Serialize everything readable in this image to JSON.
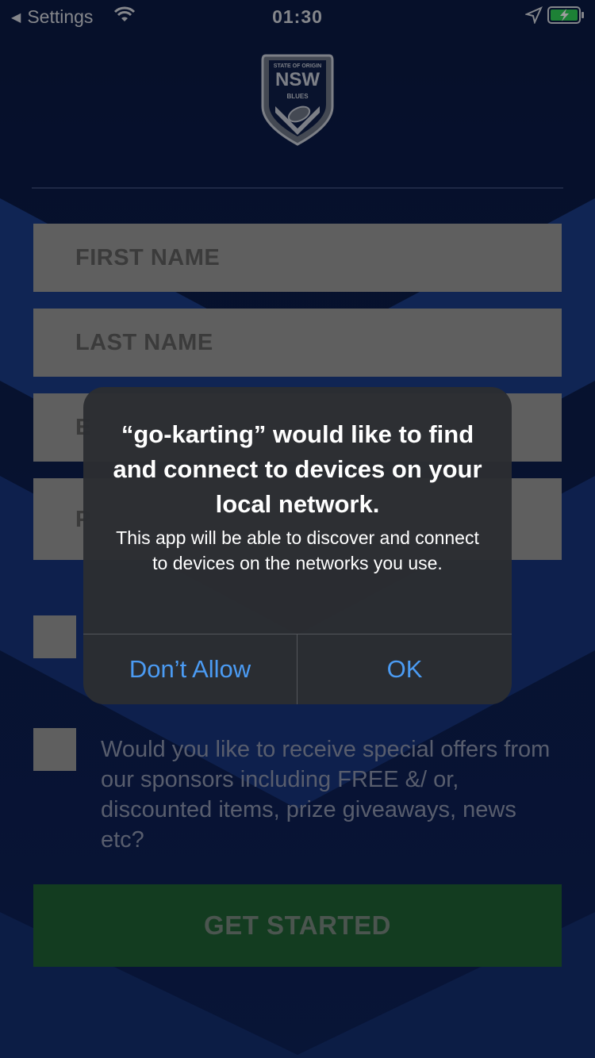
{
  "status_bar": {
    "back_label": "Settings",
    "time": "01:30",
    "icons": [
      "back-triangle-icon",
      "wifi-icon",
      "location-arrow-icon",
      "battery-charging-icon"
    ]
  },
  "logo": {
    "top_text": "STATE OF ORIGIN",
    "main_text": "NSW",
    "sub_text": "BLUES"
  },
  "form": {
    "first_name_placeholder": "FIRST NAME",
    "last_name_placeholder": "LAST NAME",
    "field3_visible_letter": "E",
    "field4_visible_letter": "P",
    "offers_text": "Would you like to receive special offers from our sponsors including FREE &/ or, discounted items, prize giveaways, news etc?",
    "submit_label": "GET STARTED"
  },
  "alert": {
    "title": "“go-karting” would like to find and connect to devices on your local network.",
    "message": "This app will be able to discover and connect to devices on the networks you use.",
    "deny_label": "Don’t Allow",
    "ok_label": "OK"
  },
  "colors": {
    "background": "#0a1a45",
    "chevron": "#1c3f8e",
    "field": "#9a9a9a",
    "submit": "#1f6135",
    "alert_bg": "#2b2d32",
    "alert_button": "#4b9bf3"
  }
}
